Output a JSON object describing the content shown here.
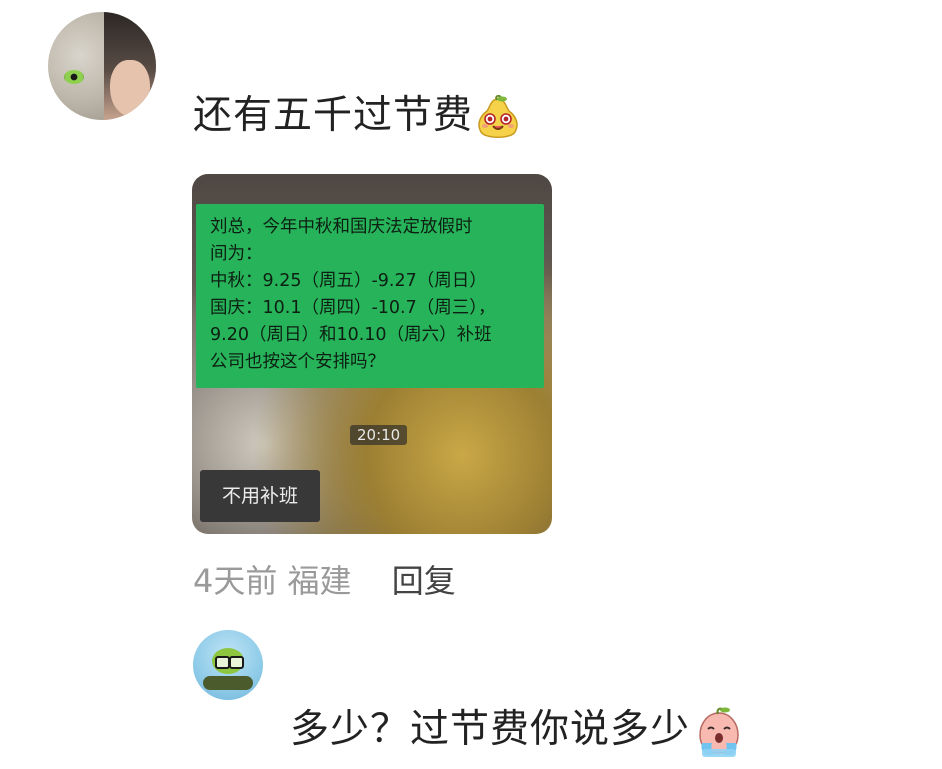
{
  "comments": [
    {
      "text": "还有五千过节费",
      "emoji": "smiling-pear-emoji",
      "screenshot": {
        "message_lines": [
          "刘总，今年中秋和国庆法定放假时",
          "间为：",
          "中秋：9.25（周五）-9.27（周日）",
          "国庆：10.1（周四）-10.7（周三），",
          "9.20（周日）和10.10（周六）补班",
          "公司也按这个安排吗？"
        ],
        "time": "20:10",
        "reply": "不用补班"
      },
      "meta": {
        "time_ago": "4天前",
        "location": "福建",
        "reply_label": "回复"
      }
    },
    {
      "text": "多少？过节费你说多少",
      "emoji": "crying-peach-emoji"
    }
  ],
  "colors": {
    "chat_green": "#27b35a",
    "meta_gray": "#9a9a9a",
    "text_dark": "#222222"
  }
}
